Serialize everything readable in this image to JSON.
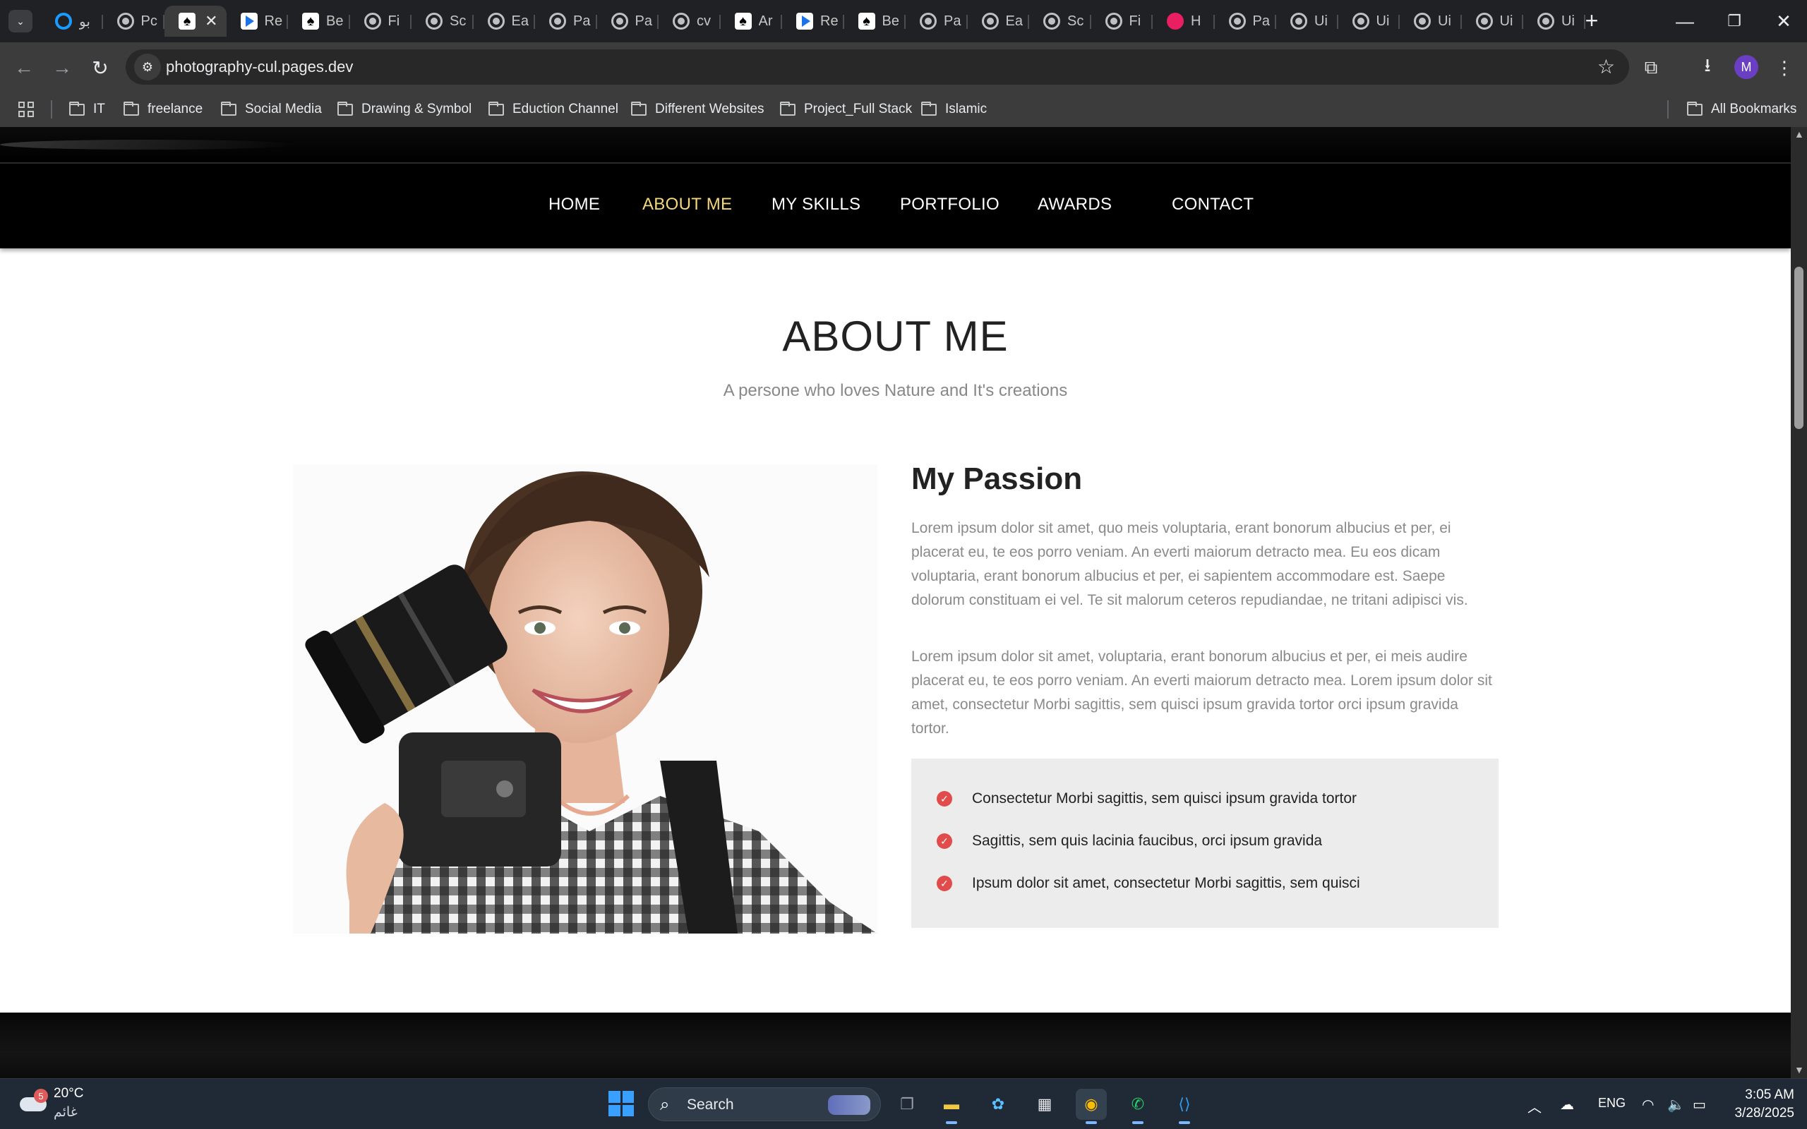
{
  "browser": {
    "tabs": [
      {
        "title": "بو",
        "icon": "ring"
      },
      {
        "title": "Pc",
        "icon": "globe"
      },
      {
        "title": "",
        "icon": "spade",
        "active": true
      },
      {
        "title": "Re",
        "icon": "play"
      },
      {
        "title": "Be",
        "icon": "spade"
      },
      {
        "title": "Fi",
        "icon": "globe"
      },
      {
        "title": "Sc",
        "icon": "globe"
      },
      {
        "title": "Ea",
        "icon": "globe"
      },
      {
        "title": "Pa",
        "icon": "globe"
      },
      {
        "title": "Pa",
        "icon": "globe"
      },
      {
        "title": "cv",
        "icon": "globe"
      },
      {
        "title": "Ar",
        "icon": "spade"
      },
      {
        "title": "Re",
        "icon": "play"
      },
      {
        "title": "Be",
        "icon": "spade"
      },
      {
        "title": "Pa",
        "icon": "globe"
      },
      {
        "title": "Ea",
        "icon": "globe"
      },
      {
        "title": "Sc",
        "icon": "globe"
      },
      {
        "title": "Fi",
        "icon": "globe"
      },
      {
        "title": "H",
        "icon": "pink"
      },
      {
        "title": "Pa",
        "icon": "globe"
      },
      {
        "title": "Ui",
        "icon": "globe"
      },
      {
        "title": "Ui",
        "icon": "globe"
      },
      {
        "title": "Ui",
        "icon": "globe"
      },
      {
        "title": "Ui",
        "icon": "globe"
      },
      {
        "title": "Ui",
        "icon": "globe"
      }
    ],
    "url": "photography-cul.pages.dev",
    "profile_initial": "M",
    "bookmarks": [
      "IT",
      "freelance",
      "Social Media",
      "Drawing & Symbol",
      "Eduction Channel",
      "Different Websites",
      "Project_Full Stack",
      "Islamic"
    ],
    "all_bookmarks": "All Bookmarks"
  },
  "site": {
    "nav": [
      "HOME",
      "ABOUT ME",
      "MY SKILLS",
      "PORTFOLIO",
      "AWARDS",
      "CONTACT"
    ],
    "active_nav": "ABOUT ME",
    "active_color": "#f5d77d",
    "about_title": "ABOUT ME",
    "about_subtitle": "A persone who loves Nature and It's creations",
    "passion_title": "My Passion",
    "paragraph_1": "Lorem ipsum dolor sit amet, quo meis voluptaria, erant bonorum albucius et per, ei placerat eu, te eos porro veniam. An everti maiorum detracto mea. Eu eos dicam voluptaria, erant bonorum albucius et per, ei sapientem accommodare est. Saepe dolorum constituam ei vel. Te sit malorum ceteros repudiandae, ne tritani adipisci vis.",
    "paragraph_2": "Lorem ipsum dolor sit amet, voluptaria, erant bonorum albucius et per, ei meis audire placerat eu, te eos porro veniam. An everti maiorum detracto mea. Lorem ipsum dolor sit amet, consectetur Morbi sagittis, sem quisci ipsum gravida tortor orci ipsum gravida tortor.",
    "features": [
      "Consectetur Morbi sagittis, sem quisci ipsum gravida tortor",
      "Sagittis, sem quis lacinia faucibus, orci ipsum gravida",
      "Ipsum dolor sit amet, consectetur Morbi sagittis, sem quisci"
    ],
    "check_color": "#e14b4b"
  },
  "taskbar": {
    "weather_temp": "20°C",
    "weather_condition": "غائم",
    "weather_badge": "5",
    "search_label": "Search",
    "language": "ENG",
    "time": "3:05 AM",
    "date": "3/28/2025"
  }
}
